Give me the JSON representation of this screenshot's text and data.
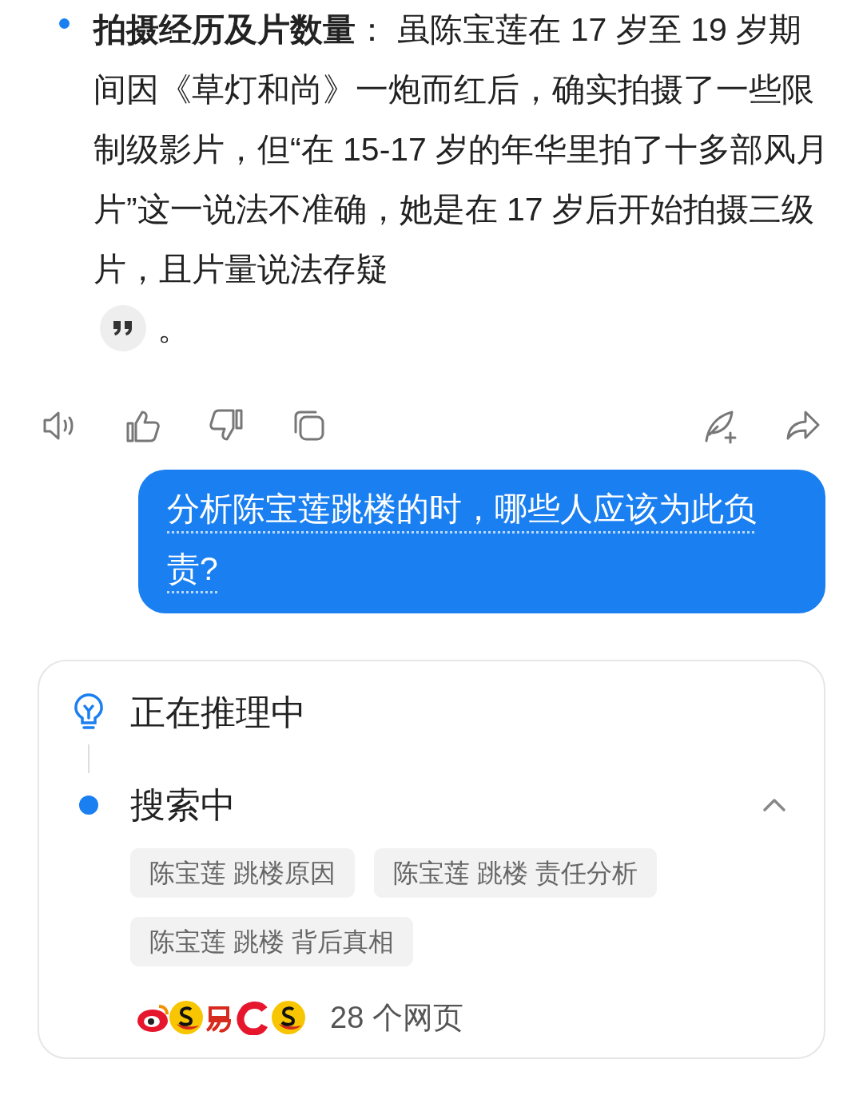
{
  "answer": {
    "text": "**拍摄经历及片数量**：  虽陈宝莲在 17 岁至 19 岁期间因《草灯和尚》一炮而红后，确实拍摄了一些限制级影片，但“在 15-17 岁的年华里拍了十多部风月片”这一说法不准确，她是在 17 岁后开始拍摄三级片，且片量说法存疑",
    "end": "。"
  },
  "user_message": "分析陈宝莲跳楼的时，哪些人应该为此负责?",
  "reasoning": {
    "steps": [
      {
        "kind": "thinking",
        "label": "正在推理中"
      },
      {
        "kind": "search",
        "label": "搜索中",
        "expanded": true
      }
    ],
    "queries": [
      "陈宝莲 跳楼原因",
      "陈宝莲 跳楼 责任分析",
      "陈宝莲 跳楼 背后真相"
    ],
    "sources": "28 个网页"
  }
}
